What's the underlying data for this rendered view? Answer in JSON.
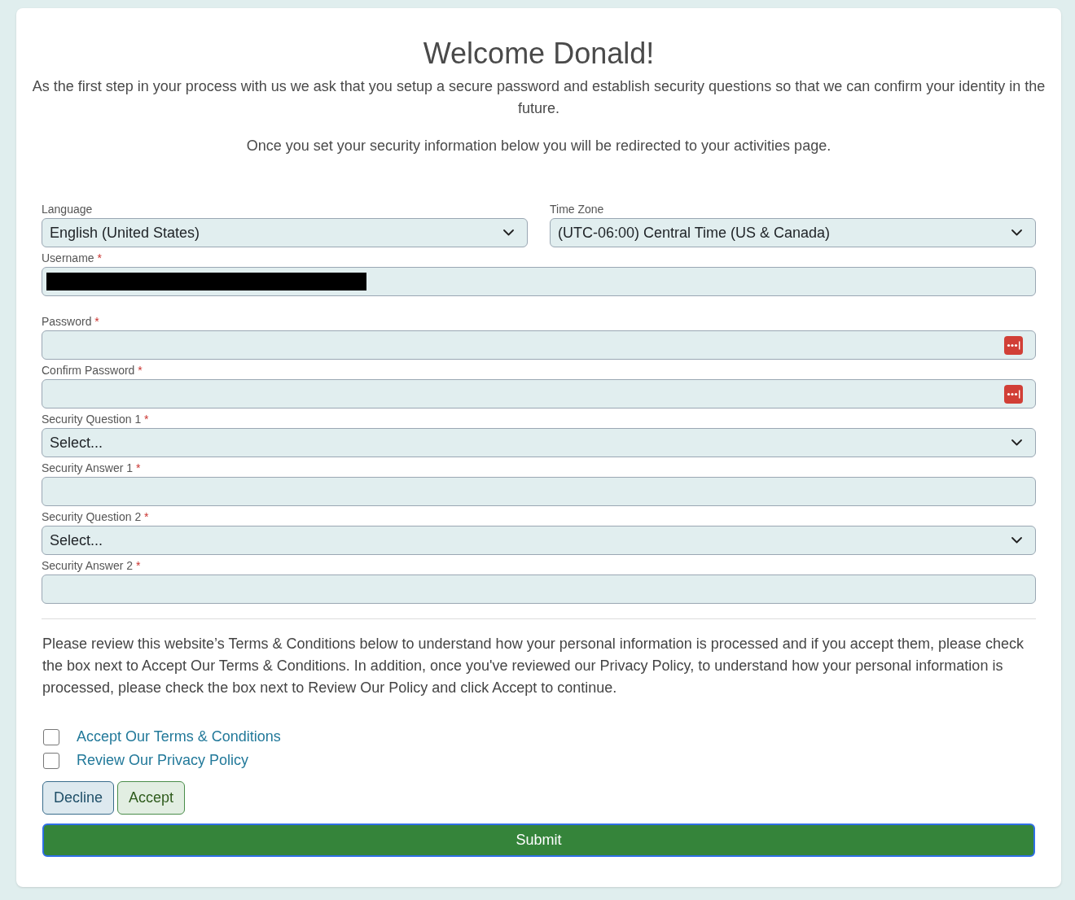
{
  "header": {
    "title": "Welcome Donald!",
    "intro": "As the first step in your process with us we ask that you setup a secure password and establish security questions so that we can confirm your identity in the future.",
    "note": "Once you set your security information below you will be redirected to your activities page."
  },
  "locale": [
    {
      "kind": "select",
      "label": "Language",
      "value": "English (United States)"
    },
    {
      "kind": "select",
      "label": "Time Zone",
      "value": "(UTC-06:00) Central Time (US & Canada)"
    }
  ],
  "username": {
    "kind": "text",
    "label": "Username",
    "required_mark": "*",
    "redacted": true
  },
  "security": [
    {
      "kind": "password",
      "label": "Password",
      "required_mark": "*"
    },
    {
      "kind": "password",
      "label": "Confirm Password",
      "required_mark": "*"
    },
    {
      "kind": "select",
      "label": "Security Question 1",
      "required_mark": "*",
      "value": "Select..."
    },
    {
      "kind": "text",
      "label": "Security Answer 1",
      "required_mark": "*"
    },
    {
      "kind": "select",
      "label": "Security Question 2",
      "required_mark": "*",
      "value": "Select..."
    },
    {
      "kind": "text",
      "label": "Security Answer 2",
      "required_mark": "*"
    }
  ],
  "consent": {
    "text": "Please review this website’s Terms & Conditions below to understand how your personal information is processed and if you accept them, please check the box next to Accept Our Terms & Conditions. In addition, once you've reviewed our Privacy Policy, to understand how your personal information is processed, please check the box next to Review Our Policy and click Accept to continue.",
    "checkboxes": [
      {
        "label": "Accept Our Terms & Conditions",
        "checked": false
      },
      {
        "label": "Review Our Privacy Policy",
        "checked": false
      }
    ]
  },
  "buttons": [
    {
      "kind": "decline",
      "label": "Decline"
    },
    {
      "kind": "accept",
      "label": "Accept"
    }
  ],
  "submit": {
    "label": "Submit",
    "focused": true
  }
}
